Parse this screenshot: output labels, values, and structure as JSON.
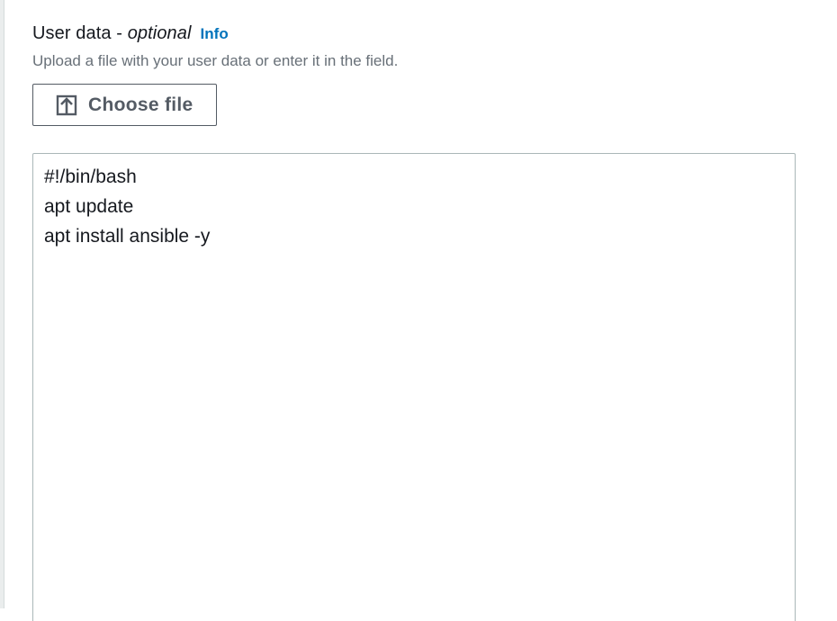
{
  "field": {
    "label": "User data - ",
    "label_optional": "optional",
    "info_link": "Info",
    "description": "Upload a file with your user data or enter it in the field."
  },
  "choose_file": {
    "label": "Choose file",
    "icon": "upload-icon"
  },
  "user_data": {
    "lines": [
      "#!/bin/bash",
      "apt update",
      "apt install ansible -y"
    ]
  },
  "colors": {
    "info_link": "#0073bb",
    "description": "#687078",
    "button_border": "#545b64",
    "textarea_border": "#aab7b8"
  }
}
